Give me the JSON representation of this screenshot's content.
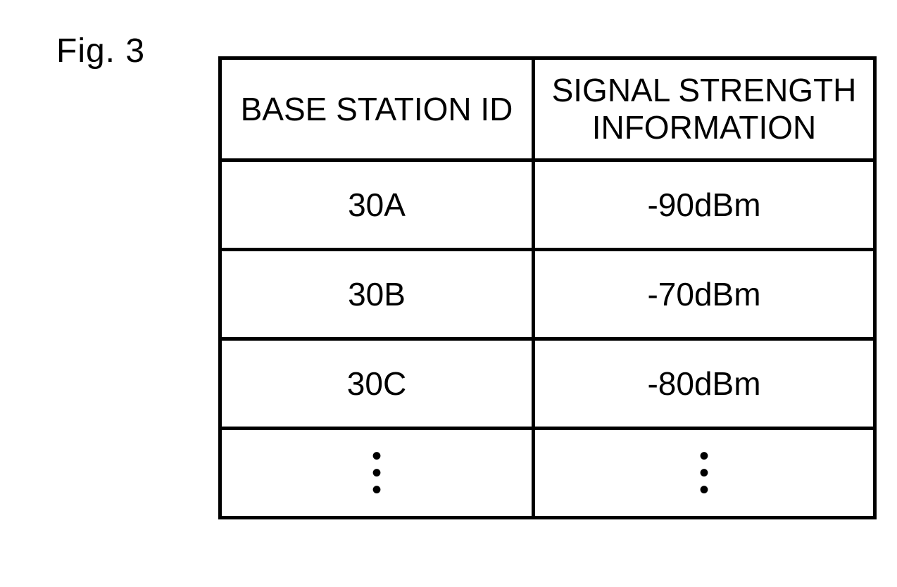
{
  "figure_label": "Fig. 3",
  "chart_data": {
    "type": "table",
    "headers": [
      "BASE STATION ID",
      "SIGNAL STRENGTH INFORMATION"
    ],
    "rows": [
      {
        "id": "30A",
        "signal": "-90dBm"
      },
      {
        "id": "30B",
        "signal": "-70dBm"
      },
      {
        "id": "30C",
        "signal": "-80dBm"
      }
    ],
    "continuation": "⋮"
  }
}
